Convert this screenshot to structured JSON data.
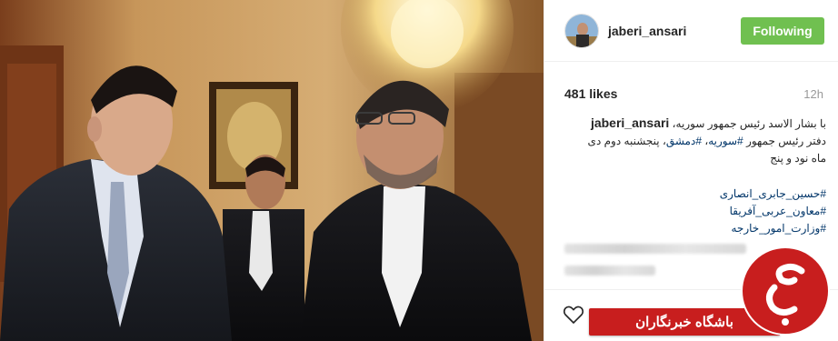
{
  "post": {
    "username": "jaberi_ansari",
    "follow_label": "Following",
    "likes": "481 likes",
    "time": "12h"
  },
  "caption": {
    "username": "jaberi_ansari",
    "line1": "با بشار الاسد رئیس جمهور سوریه،",
    "line2_pre": "دفتر رئیس جمهور",
    "tag_syria": "#سوریه",
    "tag_damascus": "#دمشق",
    "line2_post": "، پنجشنبه دوم دی",
    "line3": "ماه نود و پنج"
  },
  "hashtags": [
    "#حسین_جابری_انصاری",
    "#معاون_عربی_آفریقا",
    "#وزارت_امور_خارجه"
  ],
  "watermark": {
    "banner_text": "باشگاه خبرنگاران",
    "color": "#c81e1e"
  },
  "colors": {
    "follow_button": "#70c050",
    "hashtag": "#003569",
    "time": "#999999"
  },
  "icons": {
    "heart": "heart-outline-icon"
  }
}
